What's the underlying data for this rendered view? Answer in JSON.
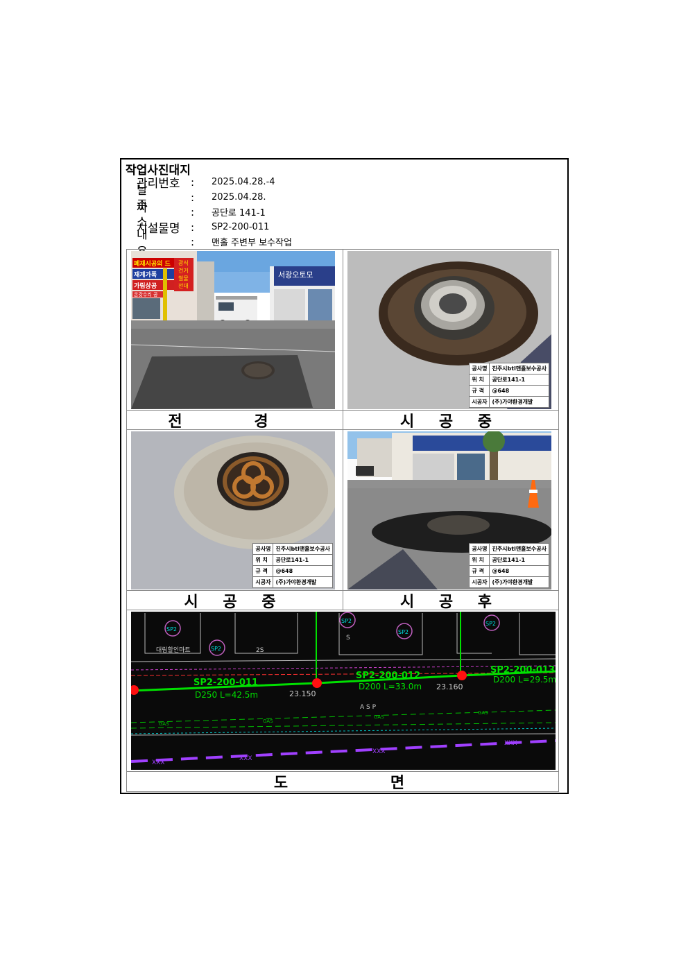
{
  "document": {
    "title": "작업사진대지",
    "fields": [
      {
        "label": "관리번호",
        "value": "2025.04.28.-4"
      },
      {
        "label": "날짜",
        "value": "2025.04.28."
      },
      {
        "label": "주소",
        "value": "공단로 141-1"
      },
      {
        "label": "시설물명",
        "value": "SP2-200-011"
      },
      {
        "label": "내용",
        "value": "맨홀 주변부 보수작업"
      }
    ],
    "colon": ":"
  },
  "photos": {
    "captions": [
      "전 경",
      "시 공 중",
      "시 공 중",
      "시 공 후"
    ],
    "stamp": {
      "rows": [
        {
          "key": "공사명",
          "value": "진주시btl맨홀보수공사"
        },
        {
          "key": "위 치",
          "value": "공단로141-1"
        },
        {
          "key": "규 격",
          "value": "@648"
        },
        {
          "key": "시공자",
          "value": "(주)가야환경개발"
        }
      ]
    },
    "shop_signs": {
      "top": "서광오토모",
      "left1": "폐재시공의 드",
      "left2": "재계가폭",
      "left3": "가림상공",
      "left4": "온갖수리 공",
      "right1": "광식",
      "right2": "건거",
      "right3": "철물",
      "right4": "전대"
    }
  },
  "plan": {
    "caption": "도 면",
    "pipe_labels": [
      {
        "id": "SP2-200-011",
        "spec": "D250 L=42.5m",
        "elev": "23.150"
      },
      {
        "id": "SP2-200-012",
        "spec": "D200 L=33.0m",
        "elev": "23.160"
      },
      {
        "id": "SP2-200-013",
        "spec": "D200 L=29.5m",
        "elev": ""
      }
    ],
    "misc_labels": {
      "building": "대림할인마트",
      "asp": "A S P",
      "gas": "GAS",
      "xxx": "XXX",
      "s": "S",
      "two_s": "2S",
      "sp_tag": "SP2"
    },
    "colors": {
      "pipe": "#00e000",
      "node": "#ff1010",
      "gas": "#00c000",
      "buried": "#a040ff",
      "text": "#cccccc"
    }
  }
}
